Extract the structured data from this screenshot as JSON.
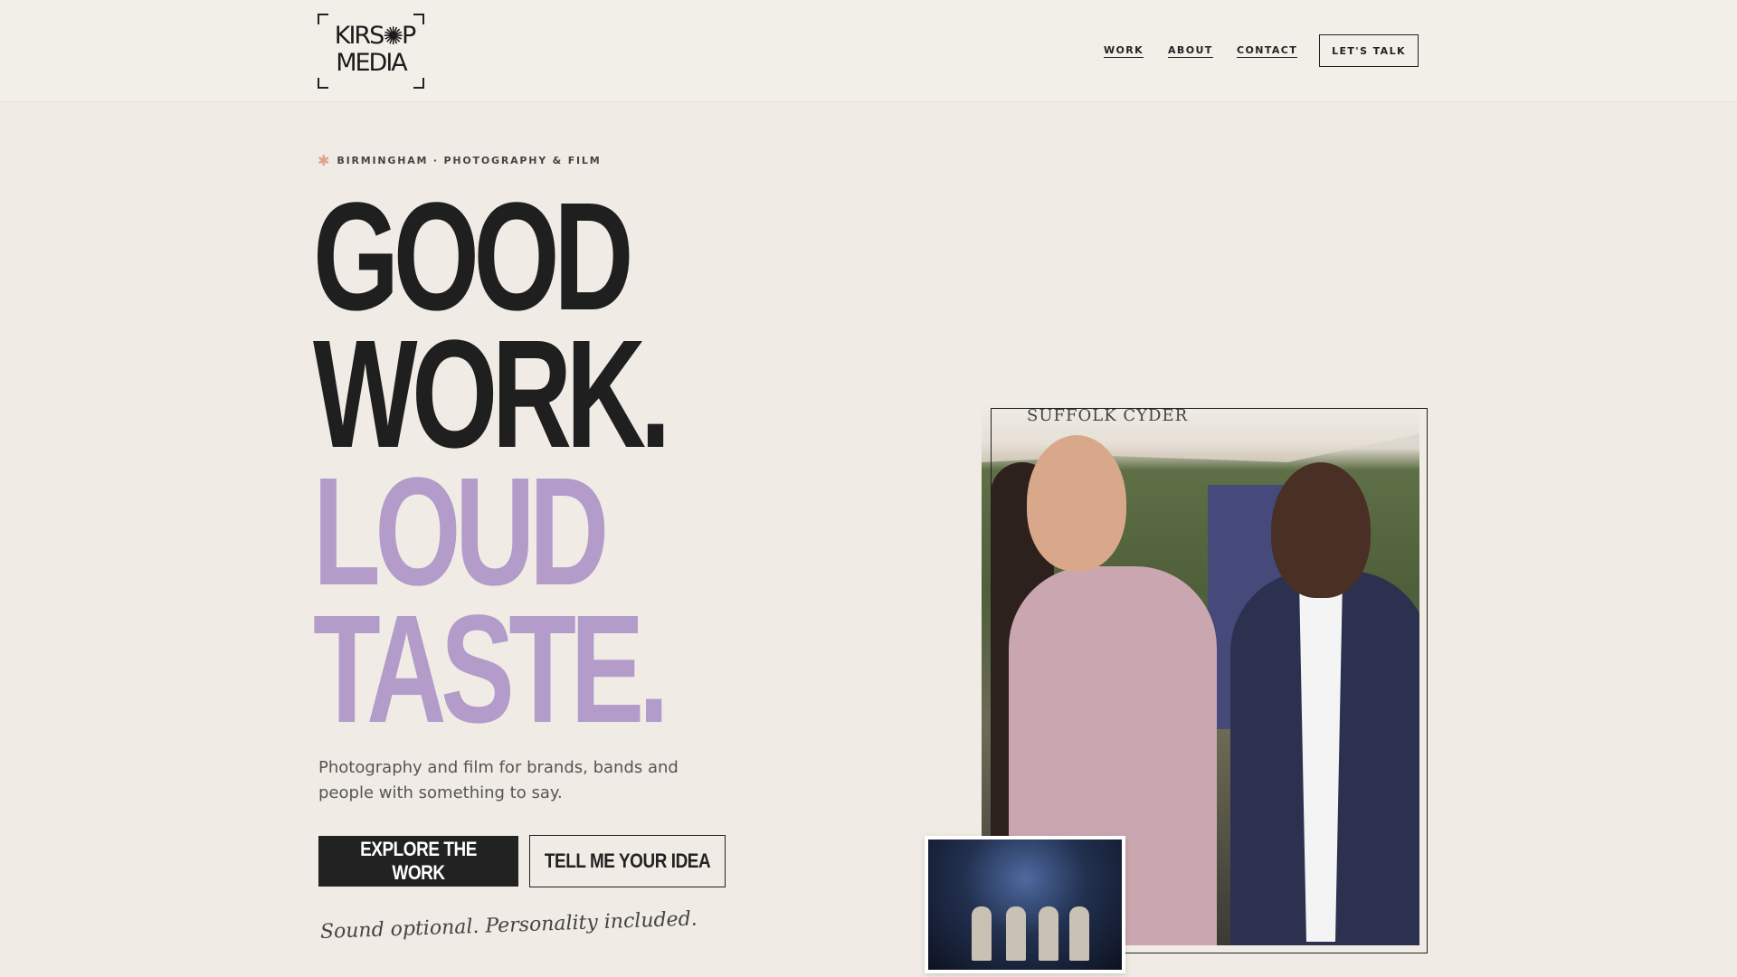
{
  "brand": {
    "logo_line1": "KIRS",
    "logo_line1_end": "P",
    "logo_line2": "MEDIA",
    "logo_alt": "Kirsop Media"
  },
  "nav": {
    "items": [
      {
        "label": "WORK"
      },
      {
        "label": "ABOUT"
      },
      {
        "label": "CONTACT"
      }
    ],
    "cta_label": "LET'S TALK"
  },
  "hero": {
    "eyebrow": "BIRMINGHAM · PHOTOGRAPHY & FILM",
    "eyebrow_icon": "asterisk-icon",
    "headline": [
      "GOOD",
      "WORK.",
      "LOUD",
      "TASTE."
    ],
    "subcopy": "Photography and film for brands, bands and people with something to say.",
    "primary_button": "EXPLORE THE WORK",
    "secondary_button": "TELL ME YOUR IDEA",
    "tagline": "Sound optional. Personality included."
  },
  "photos": {
    "main_sign_text": "SUFFOLK CYDER"
  },
  "colors": {
    "background": "#f0ece5",
    "ink": "#222222",
    "accent_purple": "#b39bca",
    "accent_peach": "#e2a08d"
  }
}
